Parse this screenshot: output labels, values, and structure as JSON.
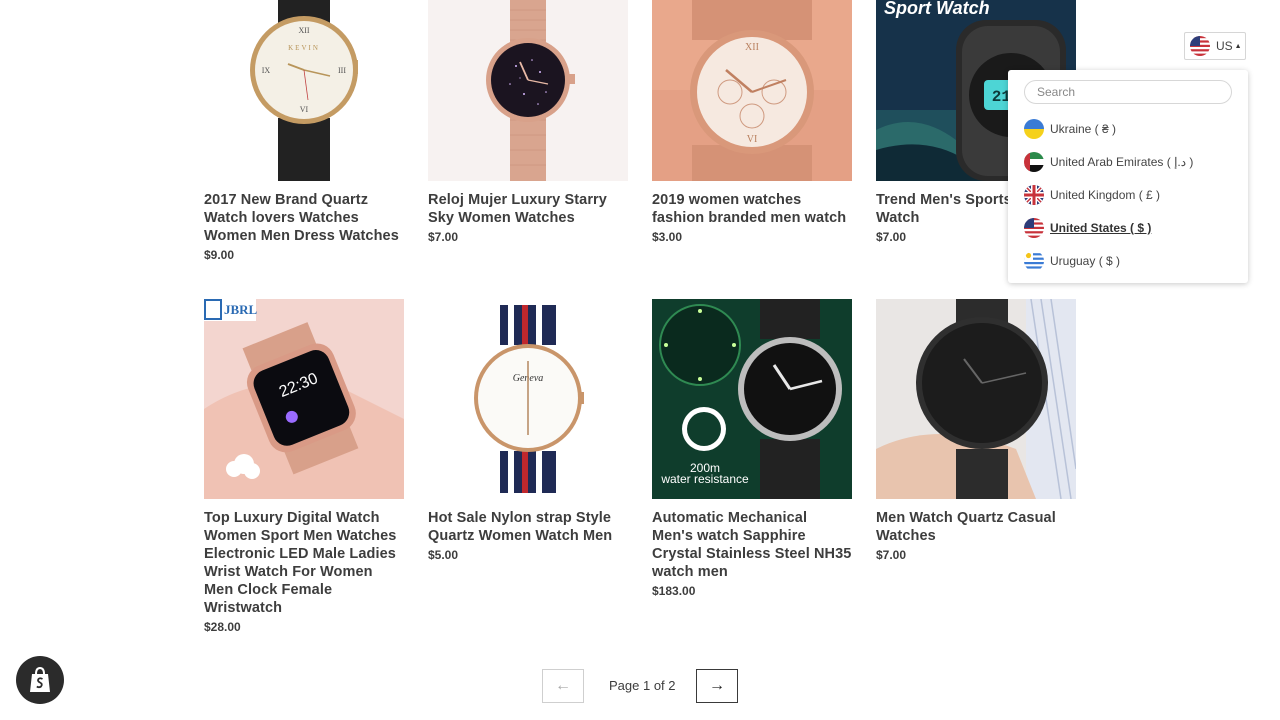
{
  "products": [
    {
      "title": "2017 New Brand Quartz Watch lovers Watches Women Men Dress Watches",
      "price": "$9.00",
      "image": "leather-strap-watch",
      "dial_text": "KEVIN"
    },
    {
      "title": "Reloj Mujer Luxury Starry Sky Women Watches",
      "price": "$7.00",
      "image": "rose-gold-starry-watch"
    },
    {
      "title": "2019 women watches fashion branded men watch",
      "price": "$3.00",
      "image": "rose-gold-chrono-watch"
    },
    {
      "title": "Trend Men's Sports LED Watch",
      "price": "$7.00",
      "image": "sport-digital-watch",
      "overlay_text": "Sport Watch"
    },
    {
      "title": "Top Luxury Digital Watch Women Sport Men Watches Electronic LED Male Ladies Wrist Watch For Women Men Clock Female Wristwatch",
      "price": "$28.00",
      "image": "smartwatch-on-wrist",
      "brand_text": "JBRL",
      "screen_time": "22:30"
    },
    {
      "title": "Hot Sale Nylon strap Style Quartz Women Watch Men",
      "price": "$5.00",
      "image": "nylon-strap-watch",
      "dial_text": "Geneva"
    },
    {
      "title": "Automatic Mechanical Men's watch Sapphire Crystal Stainless Steel NH35 watch men",
      "price": "$183.00",
      "image": "pilot-watch",
      "overlay_line1": "200m",
      "overlay_line2": "water resistance"
    },
    {
      "title": "Men Watch Quartz Casual Watches",
      "price": "$7.00",
      "image": "black-mesh-watch"
    }
  ],
  "currency": {
    "selected_code": "US",
    "search_placeholder": "Search",
    "options": [
      {
        "label": "Ukraine ( ₴ )",
        "flag": "ukraine-flag-icon",
        "selected": false
      },
      {
        "label": "United Arab Emirates ( د.إ )",
        "flag": "uae-flag-icon",
        "selected": false
      },
      {
        "label": "United Kingdom ( £ )",
        "flag": "uk-flag-icon",
        "selected": false
      },
      {
        "label": "United States ( $ )",
        "flag": "us-flag-icon",
        "selected": true
      },
      {
        "label": "Uruguay ( $ )",
        "flag": "uruguay-flag-icon",
        "selected": false
      }
    ]
  },
  "pagination": {
    "text": "Page 1 of 2",
    "prev_icon": "←",
    "next_icon": "→"
  },
  "colors": {
    "text": "#3d3d3d",
    "border": "#cfcfcf",
    "badge": "#2b2b2b"
  }
}
